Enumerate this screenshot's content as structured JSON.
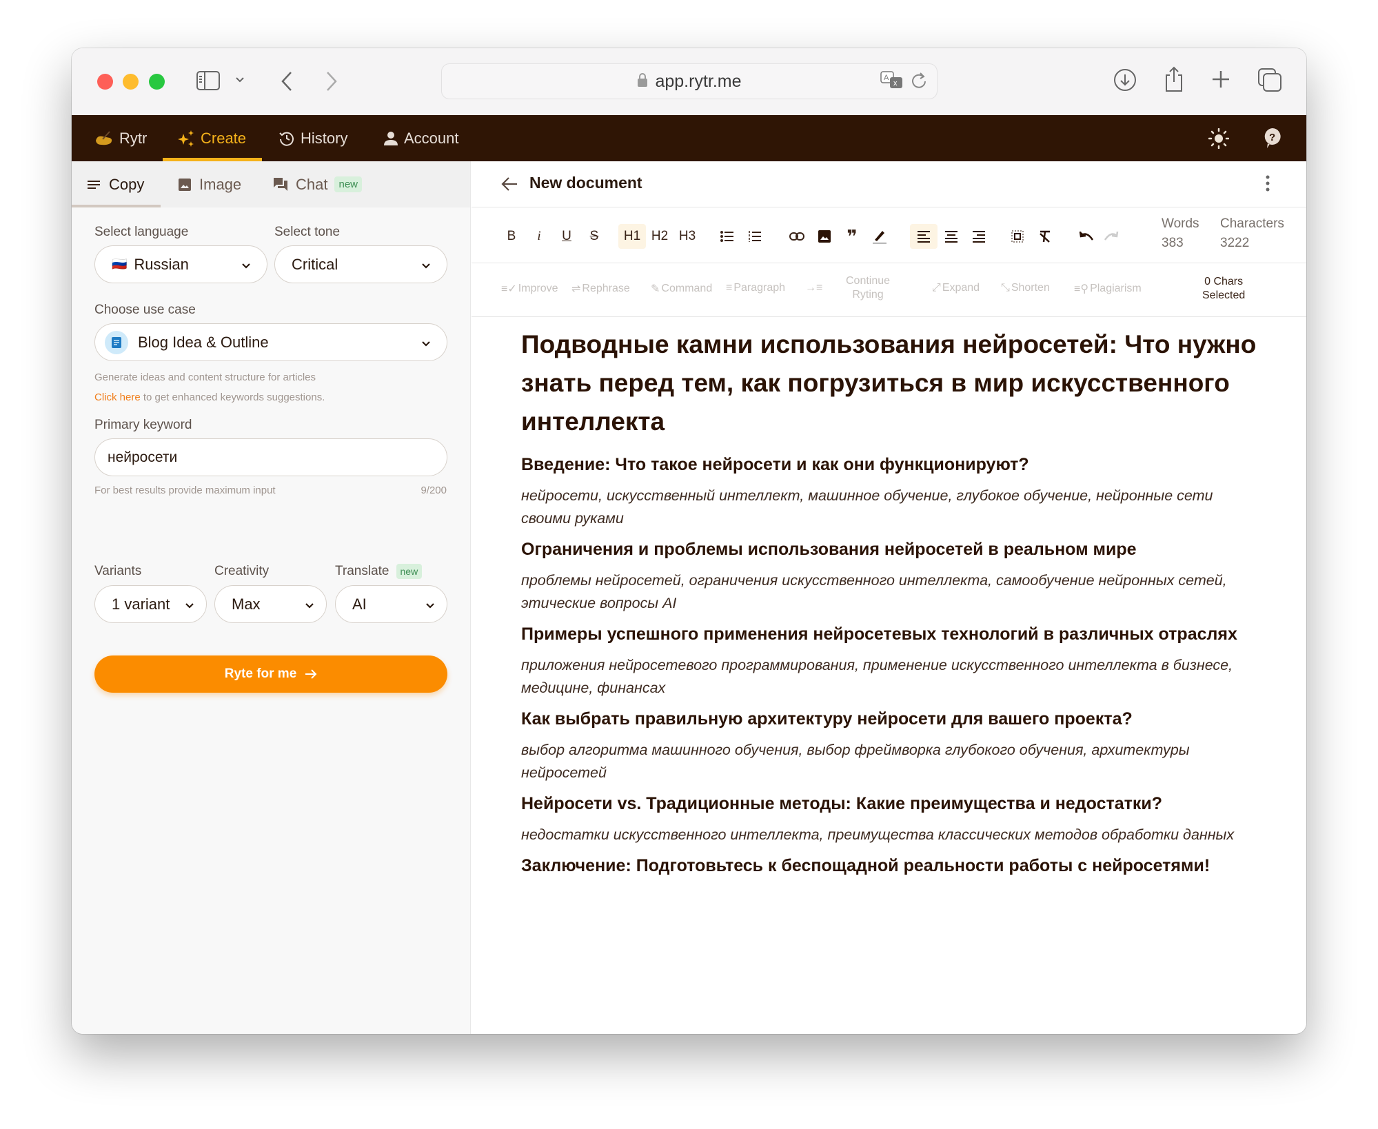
{
  "browser": {
    "url": "app.rytr.me",
    "icons": [
      "sidebar-icon",
      "chevron-down-icon",
      "back-icon",
      "forward-icon",
      "lock-icon",
      "translate-icon",
      "reload-icon",
      "download-icon",
      "share-icon",
      "new-tab-icon",
      "tabs-overview-icon"
    ]
  },
  "nav": {
    "brand": "Rytr",
    "items": [
      {
        "label": "Create",
        "icon": "sparkle-icon",
        "active": true
      },
      {
        "label": "History",
        "icon": "history-icon",
        "active": false
      },
      {
        "label": "Account",
        "icon": "user-icon",
        "active": false
      }
    ],
    "right_icons": [
      "theme-sun-icon",
      "help-icon"
    ],
    "accent": "#f5b21a",
    "background": "#2f1505"
  },
  "left": {
    "tabs": [
      {
        "label": "Copy",
        "icon": "lines-icon",
        "active": true
      },
      {
        "label": "Image",
        "icon": "image-icon",
        "active": false
      },
      {
        "label": "Chat",
        "icon": "chat-icon",
        "active": false,
        "badge": "new"
      }
    ],
    "language": {
      "label": "Select language",
      "value": "Russian",
      "flag": "🇷🇺"
    },
    "tone": {
      "label": "Select tone",
      "value": "Critical"
    },
    "use_case": {
      "label": "Choose use case",
      "value": "Blog Idea & Outline",
      "description": "Generate ideas and content structure for articles",
      "link_text": "Click here",
      "link_suffix": " to get enhanced keywords suggestions."
    },
    "keyword": {
      "label": "Primary keyword",
      "value": "нейросети",
      "hint": "For best results provide maximum input",
      "counter": "9/200"
    },
    "variants": {
      "label": "Variants",
      "value": "1 variant"
    },
    "creativity": {
      "label": "Creativity",
      "value": "Max"
    },
    "translate": {
      "label": "Translate",
      "badge": "new",
      "value": "AI"
    },
    "cta": {
      "label": "Ryte for me",
      "color": "#fb8c00"
    }
  },
  "editor": {
    "title": "New document",
    "toolbar": {
      "bold": "B",
      "italic": "i",
      "underline": "U",
      "strike": "S",
      "h1": "H1",
      "h2": "H2",
      "h3": "H3",
      "active": [
        "H1",
        "align-left"
      ]
    },
    "stats": {
      "words_label": "Words",
      "words": "383",
      "chars_label": "Characters",
      "chars": "3222"
    },
    "ai_tools": {
      "improve": "Improve",
      "rephrase": "Rephrase",
      "command": "Command",
      "paragraph": "Paragraph",
      "continue_1": "Continue",
      "continue_2": "Ryting",
      "expand": "Expand",
      "shorten": "Shorten",
      "plagiarism": "Plagiarism",
      "chars_selected_1": "0 Chars",
      "chars_selected_2": "Selected"
    },
    "document": {
      "title": "Подводные камни использования нейросетей: Что нужно знать перед тем, как погрузиться в мир искусственного интеллекта",
      "sections": [
        {
          "heading": "Введение: Что такое нейросети и как они функционируют?",
          "keywords": "нейросети, искусственный интеллект, машинное обучение, глубокое обучение, нейронные сети своими руками"
        },
        {
          "heading": "Ограничения и проблемы использования нейросетей в реальном мире",
          "keywords": "проблемы нейросетей, ограничения искусственного интеллекта, самообучение нейронных сетей, этические вопросы AI"
        },
        {
          "heading": "Примеры успешного применения нейросетевых технологий в различных отраслях",
          "keywords": "приложения нейросетевого программирования, применение искусственного интеллекта в бизнесе, медицине, финансах"
        },
        {
          "heading": "Как выбрать правильную архитектуру нейросети для вашего проекта?",
          "keywords": "выбор алгоритма машинного обучения, выбор фреймворка глубокого обучения, архитектуры нейросетей"
        },
        {
          "heading": "Нейросети vs. Традиционные методы: Какие преимущества и недостатки?",
          "keywords": "недостатки искусственного интеллекта, преимущества классических методов обработки данных"
        },
        {
          "heading": "Заключение: Подготовьтесь к беспощадной реальности работы с нейросетями!",
          "keywords": ""
        }
      ]
    }
  }
}
